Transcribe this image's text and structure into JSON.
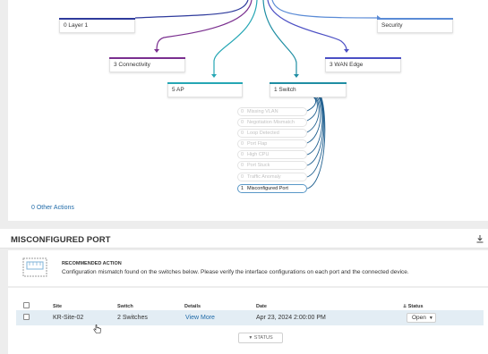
{
  "tree": {
    "nodes": {
      "layer1": "0 Layer 1",
      "security": "Security",
      "connectivity": "3 Connectivity",
      "wan_edge": "3 WAN Edge",
      "ap": "5 AP",
      "switch": "1 Switch"
    },
    "switch_items": [
      {
        "count": "0",
        "label": "Missing VLAN",
        "active": false
      },
      {
        "count": "0",
        "label": "Negotiation Mismatch",
        "active": false
      },
      {
        "count": "0",
        "label": "Loop Detected",
        "active": false
      },
      {
        "count": "0",
        "label": "Port Flap",
        "active": false
      },
      {
        "count": "0",
        "label": "High CPU",
        "active": false
      },
      {
        "count": "0",
        "label": "Port Stuck",
        "active": false
      },
      {
        "count": "0",
        "label": "Traffic Anomaly",
        "active": false
      },
      {
        "count": "1",
        "label": "Misconfigured Port",
        "active": true
      }
    ],
    "other_actions": "0 Other Actions"
  },
  "colors": {
    "layer1": "#2e3a9c",
    "security": "#5a8bd6",
    "connectivity": "#7a2f8f",
    "wan_edge": "#4b4fc4",
    "ap": "#25a6b4",
    "switch": "#1f8ea3",
    "link": "#1f6aa8",
    "row_highlight": "#e3edf4"
  },
  "section": {
    "title": "MISCONFIGURED PORT",
    "download_icon": "download-icon"
  },
  "recommendation": {
    "title": "RECOMMENDED ACTION",
    "text": "Configuration mismatch found on the switches below. Please verify the interface configurations on each port and the connected device.",
    "icon": "switch-port-icon"
  },
  "table": {
    "headers": {
      "site": "Site",
      "switch": "Switch",
      "details": "Details",
      "date": "Date",
      "status": "Status"
    },
    "rows": [
      {
        "site": "KR-Site-02",
        "switch": "2 Switches",
        "details": "View More",
        "date": "Apr 23, 2024 2:00:00 PM",
        "status": "Open"
      }
    ],
    "status_button": "STATUS"
  }
}
